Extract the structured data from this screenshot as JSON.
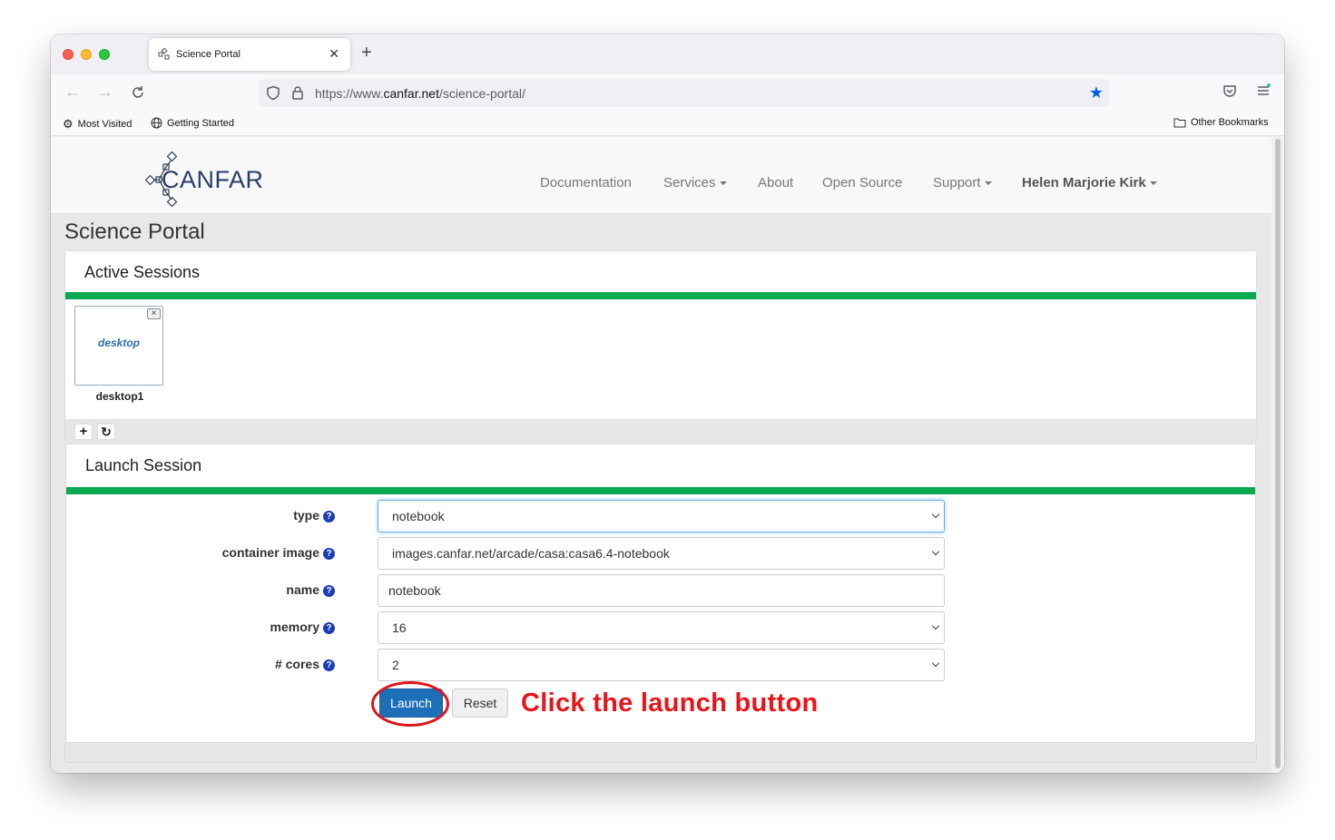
{
  "browser": {
    "tab_title": "Science Portal",
    "url_prefix": "https://www.",
    "url_domain": "canfar.net",
    "url_path": "/science-portal/",
    "bookmarks": [
      "Most Visited",
      "Getting Started"
    ],
    "other_bookmarks": "Other Bookmarks"
  },
  "nav": {
    "documentation": "Documentation",
    "services": "Services",
    "about": "About",
    "open_source": "Open Source",
    "support": "Support",
    "user": "Helen Marjorie Kirk"
  },
  "logo_text": "CANFAR",
  "page_title": "Science Portal",
  "active_sessions": {
    "title": "Active Sessions",
    "sessions": [
      {
        "type": "desktop",
        "name": "desktop1"
      }
    ]
  },
  "launch": {
    "title": "Launch Session",
    "fields": {
      "type": {
        "label": "type",
        "value": "notebook"
      },
      "image": {
        "label": "container image",
        "value": "images.canfar.net/arcade/casa:casa6.4-notebook"
      },
      "name": {
        "label": "name",
        "value": "notebook"
      },
      "memory": {
        "label": "memory",
        "value": "16"
      },
      "cores": {
        "label": "# cores",
        "value": "2"
      }
    },
    "launch_label": "Launch",
    "reset_label": "Reset"
  },
  "annotation": "Click the launch button",
  "colors": {
    "accent_green": "#0aa84f",
    "launch_blue": "#1d6fb8",
    "annotation_red": "#e8141a"
  }
}
